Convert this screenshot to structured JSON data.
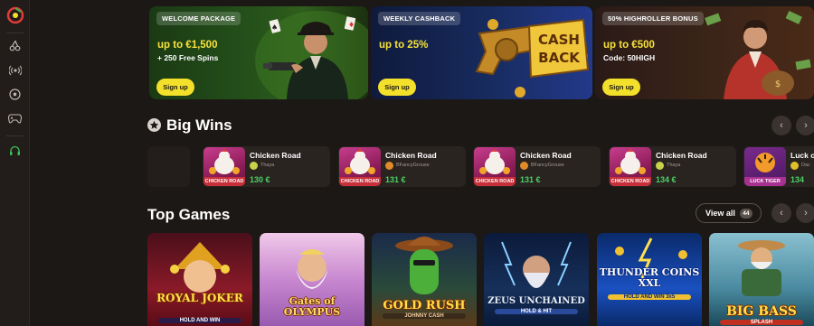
{
  "banners": [
    {
      "tag": "WELCOME PACKAGE",
      "headline": "up to €1,500",
      "subline": "+ 250 Free Spins",
      "button": "Sign up"
    },
    {
      "tag": "WEEKLY CASHBACK",
      "headline": "up to 25%",
      "subline": "",
      "button": "Sign up",
      "art_text_1": "CASH",
      "art_text_2": "BACK"
    },
    {
      "tag": "50% HIGHROLLER BONUS",
      "headline": "up to €500",
      "subline": "Code: 50HIGH",
      "button": "Sign up"
    }
  ],
  "big_wins": {
    "title": "Big Wins",
    "items": [
      {
        "game": "Chicken Road",
        "user": "Thaya",
        "amount": "130 €",
        "thumb_label": "CHICKEN ROAD"
      },
      {
        "game": "Chicken Road",
        "user": "BFancyGrouse",
        "amount": "131 €",
        "thumb_label": "CHICKEN ROAD"
      },
      {
        "game": "Chicken Road",
        "user": "BFancyGrouse",
        "amount": "131 €",
        "thumb_label": "CHICKEN ROAD"
      },
      {
        "game": "Chicken Road",
        "user": "Thaya",
        "amount": "134 €",
        "thumb_label": "CHICKEN ROAD"
      },
      {
        "game": "Luck o",
        "user": "Dac",
        "amount": "134",
        "thumb_label": "LUCK TIGER"
      }
    ]
  },
  "top_games": {
    "title": "Top Games",
    "view_all": "View all",
    "count": "44",
    "games": [
      {
        "title": "ROYAL JOKER",
        "sub": "HOLD AND WIN"
      },
      {
        "title": "Gates of OLYMPUS",
        "sub": ""
      },
      {
        "title": "GOLD RUSH",
        "sub": "JOHNNY CASH"
      },
      {
        "title": "ZEUS UNCHAINED",
        "sub": "HOLD & HIT"
      },
      {
        "title": "THUNDER COINS XXL",
        "sub": "HOLD AND WIN 3x5"
      },
      {
        "title": "BIG BASS",
        "sub": "SPLASH"
      }
    ]
  },
  "colors": {
    "accent_yellow": "#f3e02a",
    "win_green": "#49d164",
    "background": "#1c1815"
  }
}
